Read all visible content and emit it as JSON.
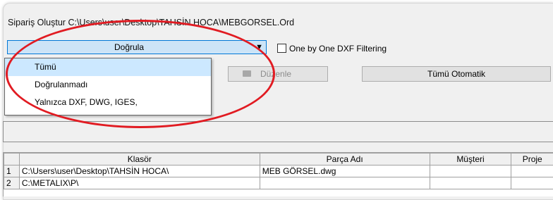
{
  "window": {
    "title": "Sipariş Oluştur C:\\Users\\user\\Desktop\\TAHSİN HOCA\\MEBGORSEL.Ord"
  },
  "toolbar": {
    "verify_combo": {
      "selected": "Doğrula"
    },
    "dxf_filter": {
      "label": "One by One DXF Filtering",
      "checked": false
    },
    "edit_button": {
      "label": "Düzenle",
      "enabled": false
    },
    "auto_button": {
      "label": "Tümü Otomatik"
    }
  },
  "dropdown": {
    "items": [
      {
        "label": "Tümü",
        "selected": true
      },
      {
        "label": "Doğrulanmadı",
        "selected": false
      },
      {
        "label": "Yalnızca DXF, DWG, IGES,",
        "selected": false
      }
    ]
  },
  "grid": {
    "columns": [
      "Klasör",
      "Parça Adı",
      "Müşteri",
      "Proje"
    ],
    "rows": [
      {
        "num": "1",
        "klasor": "C:\\Users\\user\\Desktop\\TAHSİN HOCA\\",
        "parca": "MEB GÖRSEL.dwg",
        "musteri": "",
        "proje": ""
      },
      {
        "num": "2",
        "klasor": "C:\\METALIX\\P\\",
        "parca": "",
        "musteri": "",
        "proje": ""
      }
    ]
  },
  "colors": {
    "highlight_circle": "#e11b22",
    "selection": "#cce8ff",
    "combo_focus": "#cce4f7"
  }
}
